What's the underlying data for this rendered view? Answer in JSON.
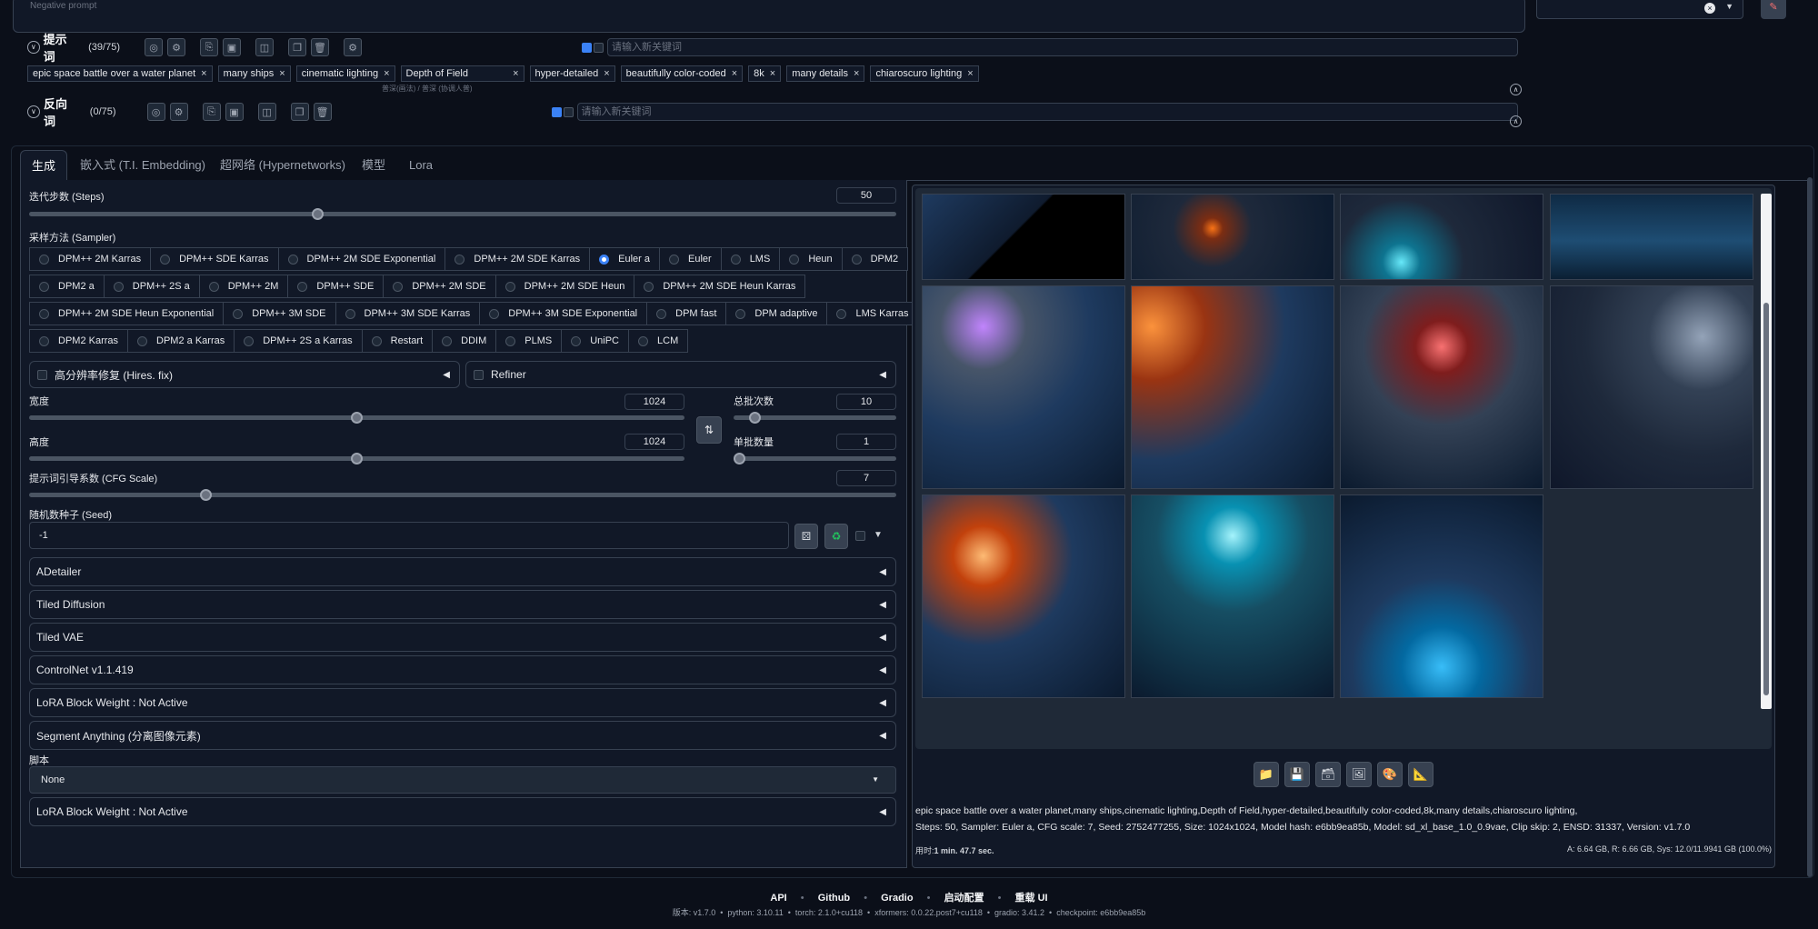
{
  "top": {
    "negative_placeholder": "Negative prompt"
  },
  "prompt_bar": {
    "title": "提示词",
    "count": "(39/75)",
    "keyword_placeholder": "请输入新关键词",
    "tags": [
      "epic space battle over a water planet",
      "many ships",
      "cinematic lighting",
      "Depth of Field",
      "hyper-detailed",
      "beautifully color-coded",
      "8k",
      "many details",
      "chiaroscuro lighting"
    ],
    "tag_hint": "普深(画法) / 普深 (协调人普)"
  },
  "negative_bar": {
    "title": "反向词",
    "count": "(0/75)",
    "keyword_placeholder": "请输入新关键词"
  },
  "tabs": [
    "生成",
    "嵌入式 (T.I. Embedding)",
    "超网络 (Hypernetworks)",
    "模型",
    "Lora"
  ],
  "steps": {
    "label": "迭代步数 (Steps)",
    "value": "50",
    "fraction": 0.33
  },
  "sampler": {
    "label": "采样方法 (Sampler)",
    "selected": "Euler a",
    "rows": [
      [
        "DPM++ 2M Karras",
        "DPM++ SDE Karras",
        "DPM++ 2M SDE Exponential",
        "DPM++ 2M SDE Karras",
        "Euler a",
        "Euler",
        "LMS",
        "Heun",
        "DPM2"
      ],
      [
        "DPM2 a",
        "DPM++ 2S a",
        "DPM++ 2M",
        "DPM++ SDE",
        "DPM++ 2M SDE",
        "DPM++ 2M SDE Heun",
        "DPM++ 2M SDE Heun Karras"
      ],
      [
        "DPM++ 2M SDE Heun Exponential",
        "DPM++ 3M SDE",
        "DPM++ 3M SDE Karras",
        "DPM++ 3M SDE Exponential",
        "DPM fast",
        "DPM adaptive",
        "LMS Karras"
      ],
      [
        "DPM2 Karras",
        "DPM2 a Karras",
        "DPM++ 2S a Karras",
        "Restart",
        "DDIM",
        "PLMS",
        "UniPC",
        "LCM"
      ]
    ]
  },
  "hires": {
    "label": "高分辨率修复 (Hires. fix)"
  },
  "refiner": {
    "label": "Refiner"
  },
  "width": {
    "label": "宽度",
    "value": "1024",
    "fraction": 0.5
  },
  "height": {
    "label": "高度",
    "value": "1024",
    "fraction": 0.5
  },
  "batch_count": {
    "label": "总批次数",
    "value": "10",
    "fraction": 0.1
  },
  "batch_size": {
    "label": "单批数量",
    "value": "1",
    "fraction": 0.0
  },
  "cfg": {
    "label": "提示词引导系数 (CFG Scale)",
    "value": "7",
    "fraction": 0.2
  },
  "seed": {
    "label": "随机数种子 (Seed)",
    "value": "-1"
  },
  "accordions": [
    "ADetailer",
    "Tiled Diffusion",
    "Tiled VAE",
    "ControlNet v1.1.419",
    "LoRA Block Weight : Not Active",
    "Segment Anything (分离图像元素)"
  ],
  "script": {
    "label": "脚本",
    "value": "None"
  },
  "bottom_accordion": "LoRA Block Weight : Not Active",
  "info": {
    "line1": "epic space battle over a water planet,many ships,cinematic lighting,Depth of Field,hyper-detailed,beautifully color-coded,8k,many details,chiaroscuro lighting,",
    "line2": "Steps: 50, Sampler: Euler a, CFG scale: 7, Seed: 2752477255, Size: 1024x1024, Model hash: e6bb9ea85b, Model: sd_xl_base_1.0_0.9vae, Clip skip: 2, ENSD: 31337, Version: v1.7.0",
    "time_label": "用时:",
    "time_value": "1 min. 47.7 sec.",
    "mem": "A: 6.64 GB, R: 6.66 GB, Sys: 12.0/11.9941 GB (100.0%)"
  },
  "footer": {
    "links": [
      "API",
      "Github",
      "Gradio",
      "启动配置",
      "重载 UI"
    ],
    "version_line": "版本: v1.7.0  •  python: 3.10.11  •  torch: 2.1.0+cu118  •  xformers: 0.0.22.post7+cu118  •  gradio: 3.41.2  •  checkpoint: e6bb9ea85b"
  },
  "colors": {
    "accent": "#3b82f6",
    "background": "#0b0f19",
    "panel": "#1f2937"
  }
}
